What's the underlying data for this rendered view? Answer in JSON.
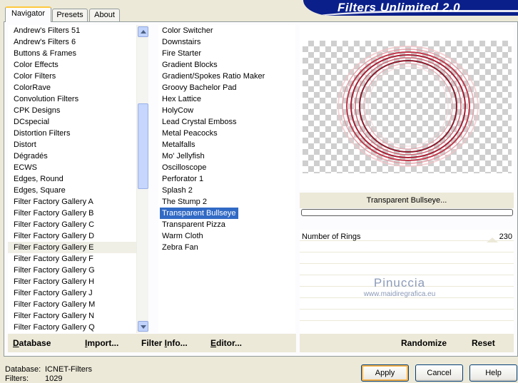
{
  "app": {
    "title": "Filters Unlimited 2.0"
  },
  "tabs": [
    {
      "label": "Navigator",
      "active": true
    },
    {
      "label": "Presets",
      "active": false
    },
    {
      "label": "About",
      "active": false
    }
  ],
  "categories": [
    "Andrew's Filters 51",
    "Andrew's Filters 6",
    "Buttons & Frames",
    "Color Effects",
    "Color Filters",
    "ColorRave",
    "Convolution Filters",
    "CPK Designs",
    "DCspecial",
    "Distortion Filters",
    "Distort",
    "Dégradés",
    "ECWS",
    "Edges, Round",
    "Edges, Square",
    "Filter Factory Gallery A",
    "Filter Factory Gallery B",
    "Filter Factory Gallery C",
    "Filter Factory Gallery D",
    "Filter Factory Gallery E",
    "Filter Factory Gallery F",
    "Filter Factory Gallery G",
    "Filter Factory Gallery H",
    "Filter Factory Gallery J",
    "Filter Factory Gallery M",
    "Filter Factory Gallery N",
    "Filter Factory Gallery Q"
  ],
  "selected_category": "Filter Factory Gallery E",
  "filters": [
    "Color Switcher",
    "Downstairs",
    "Fire Starter",
    "Gradient Blocks",
    "Gradient/Spokes Ratio Maker",
    "Groovy Bachelor Pad",
    "Hex Lattice",
    "HolyCow",
    "Lead Crystal Emboss",
    "Metal Peacocks",
    "Metalfalls",
    "Mo' Jellyfish",
    "Oscilloscope",
    "Perforator 1",
    "Splash 2",
    "The Stump 2",
    "Transparent Bullseye",
    "Transparent Pizza",
    "Warm Cloth",
    "Zebra Fan"
  ],
  "selected_filter": "Transparent Bullseye",
  "filter_name_display": "Transparent Bullseye...",
  "parameters": [
    {
      "label": "Number of Rings",
      "value": "230"
    }
  ],
  "watermark": {
    "name": "Pinuccia",
    "url": "www.maidiregrafica.eu"
  },
  "toolbar": {
    "database": {
      "u": "D",
      "rest": "atabase"
    },
    "import": {
      "u": "I",
      "rest": "mport..."
    },
    "filter_info": {
      "pre": "Filter ",
      "u": "I",
      "rest": "nfo..."
    },
    "editor": {
      "u": "E",
      "rest": "ditor..."
    },
    "randomize": "Randomize",
    "reset": "Reset"
  },
  "status": {
    "database_label": "Database:",
    "database_value": "ICNET-Filters",
    "filters_label": "Filters:",
    "filters_value": "1029"
  },
  "buttons": {
    "apply": "Apply",
    "cancel": "Cancel",
    "help": "Help"
  },
  "colors": {
    "selection": "#316ac5",
    "banner": "#0a1f8a",
    "face": "#ece9d8"
  }
}
